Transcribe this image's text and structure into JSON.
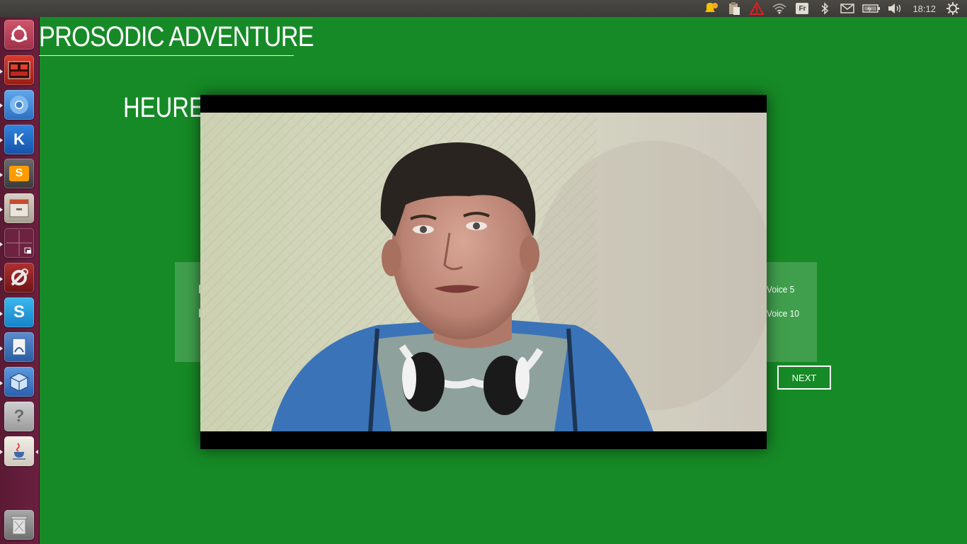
{
  "top_panel": {
    "keyboard_layout": "Fr",
    "clock": "18:12",
    "indicators": [
      "notification-bell-icon",
      "clipboard-icon",
      "warning-icon",
      "wifi-icon",
      "keyboard-layout-icon",
      "bluetooth-icon",
      "mail-icon",
      "battery-icon",
      "volume-icon",
      "clock",
      "system-gear-icon"
    ]
  },
  "launcher": {
    "items": [
      {
        "name": "ubuntu-dash-icon",
        "color": "#c83c52"
      },
      {
        "name": "movie-editor-icon",
        "color": "#c22a1e"
      },
      {
        "name": "chromium-icon",
        "color": "#3f8fd8"
      },
      {
        "name": "kile-icon",
        "color": "#1d6fd1"
      },
      {
        "name": "sublime-text-icon",
        "color": "#4d4d4d"
      },
      {
        "name": "file-cabinet-icon",
        "color": "#c2b9ad"
      },
      {
        "name": "workspace-switcher-icon",
        "color": "#6d2340"
      },
      {
        "name": "system-settings-icon",
        "color": "#8a1a1a"
      },
      {
        "name": "skype-icon",
        "color": "#1ea6e1"
      },
      {
        "name": "document-viewer-icon",
        "color": "#3b6bb0"
      },
      {
        "name": "virtualbox-icon",
        "color": "#3f7ccc"
      },
      {
        "name": "help-icon",
        "color": "#b5b5b5"
      },
      {
        "name": "java-icon",
        "color": "#e8e4dc"
      },
      {
        "name": "trash-icon",
        "color": "#8e8e8e"
      }
    ],
    "help_glyph": "?",
    "skype_glyph": "S",
    "kile_glyph": "K",
    "sublime_glyph": "S"
  },
  "app": {
    "title": "PROSODIC ADVENTURE",
    "subtitle_partial": "HEUREU",
    "voices": {
      "voice5": "Voice 5",
      "voice10": "Voice 10"
    },
    "next_label": "NEXT",
    "background_color": "#168a26"
  },
  "video": {
    "present": true
  }
}
